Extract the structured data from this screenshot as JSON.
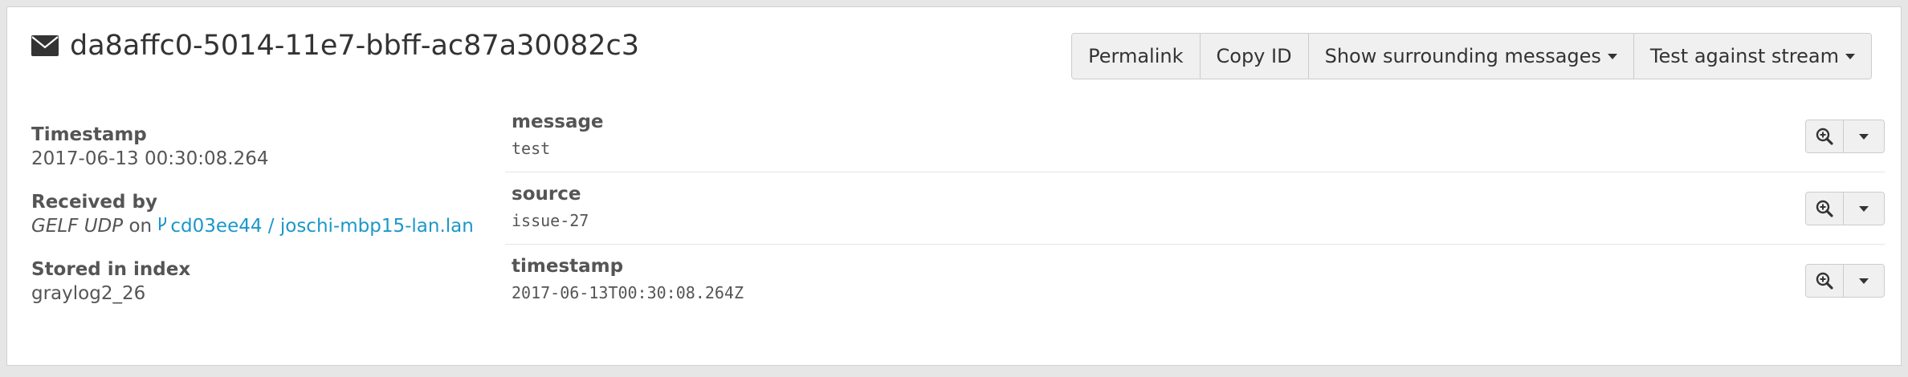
{
  "message": {
    "id": "da8affc0-5014-11e7-bbff-ac87a30082c3",
    "icon": "envelope-icon"
  },
  "toolbar": {
    "permalink_label": "Permalink",
    "copy_id_label": "Copy ID",
    "surrounding_label": "Show surrounding messages",
    "test_stream_label": "Test against stream"
  },
  "meta": {
    "timestamp_label": "Timestamp",
    "timestamp_value": "2017-06-13 00:30:08.264",
    "received_label": "Received by",
    "received_input": "GELF UDP",
    "received_on": "on",
    "received_node": "cd03ee44 / joschi-mbp15-lan.lan",
    "stored_label": "Stored in index",
    "stored_value": "graylog2_26"
  },
  "fields": [
    {
      "name": "message",
      "value": "test"
    },
    {
      "name": "source",
      "value": "issue-27"
    },
    {
      "name": "timestamp",
      "value": "2017-06-13T00:30:08.264Z"
    }
  ],
  "colors": {
    "link": "#1a98c9",
    "button_bg": "#f0f0f0",
    "text": "#333333"
  }
}
